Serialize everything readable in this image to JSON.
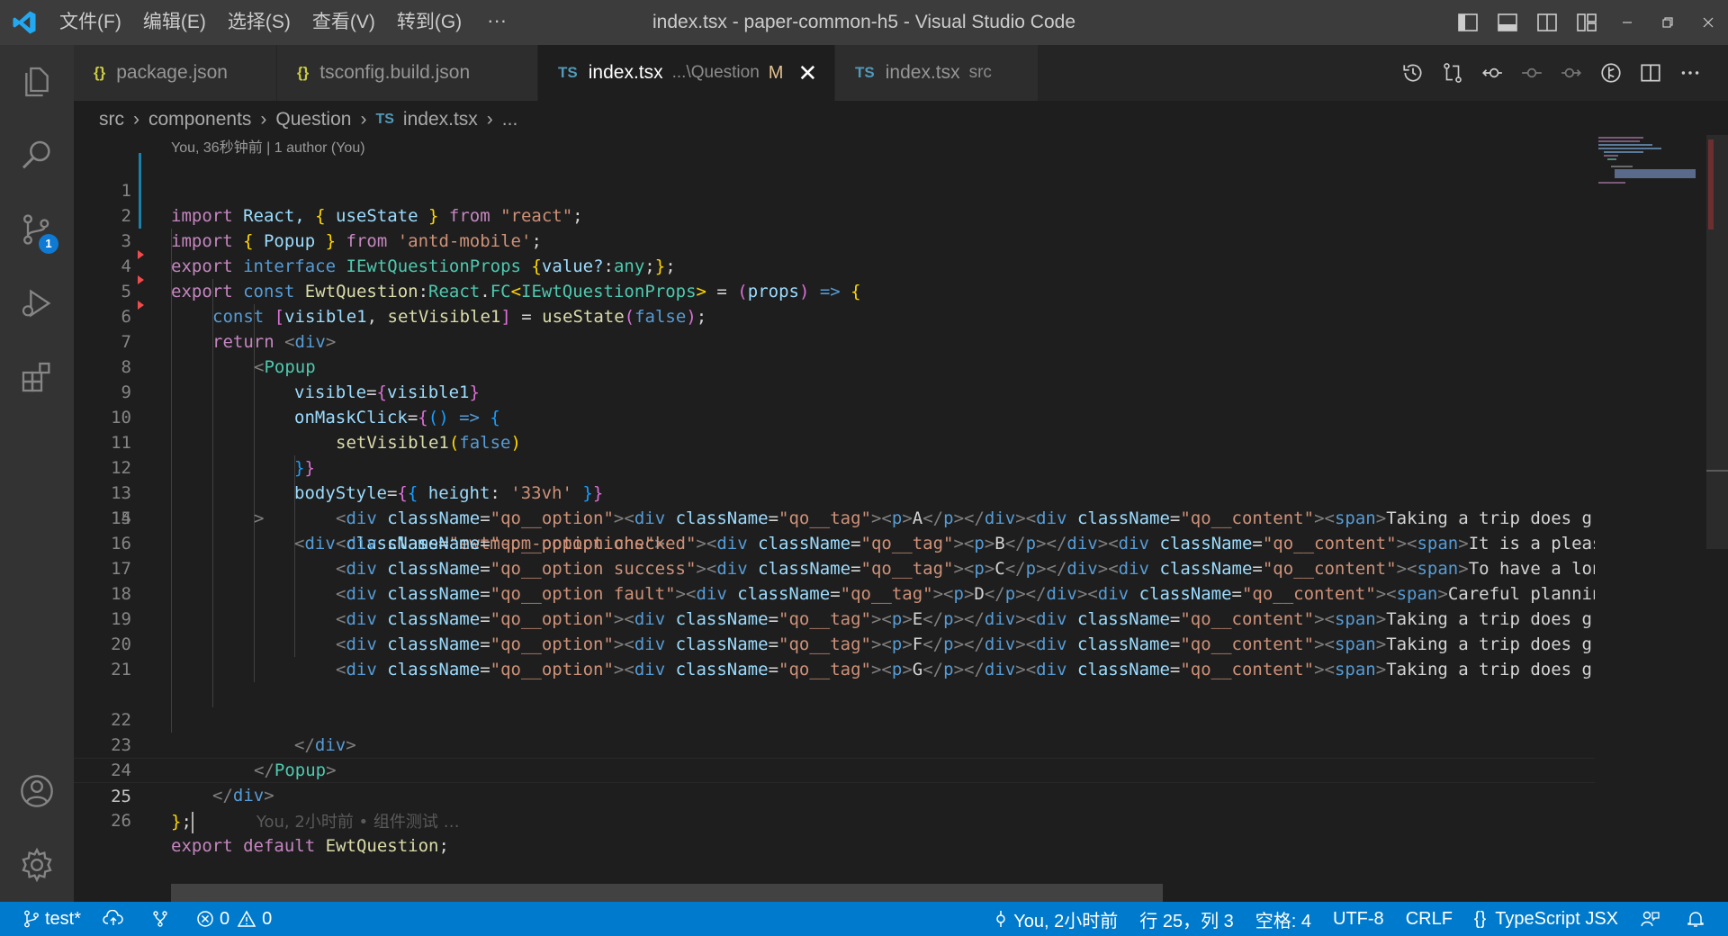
{
  "window": {
    "title": "index.tsx - paper-common-h5 - Visual Studio Code",
    "menu": [
      "文件(F)",
      "编辑(E)",
      "选择(S)",
      "查看(V)",
      "转到(G)"
    ],
    "more": "···"
  },
  "tabs": [
    {
      "icon": "{}",
      "label": "package.json"
    },
    {
      "icon": "{}",
      "label": "tsconfig.build.json"
    },
    {
      "icon": "TS",
      "label": "index.tsx",
      "desc": "...\\Question",
      "status": "M",
      "close": "✕"
    },
    {
      "icon": "TS",
      "label": "index.tsx",
      "desc": "src"
    }
  ],
  "breadcrumb": {
    "items": [
      "src",
      "components",
      "Question"
    ],
    "file_icon": "TS",
    "file": "index.tsx",
    "tail": "..."
  },
  "codelens": "You, 36秒钟前 | 1 author (You)",
  "line_numbers": [
    "1",
    "2",
    "3",
    "4",
    "5",
    "6",
    "7",
    "8",
    "9",
    "10",
    "11",
    "12",
    "13",
    "14",
    "15",
    "16",
    "17",
    "18",
    "19",
    "20",
    "21",
    "22",
    "23",
    "24",
    "25",
    "26"
  ],
  "code": {
    "l1": [
      "import",
      " React, ",
      "{",
      " useState ",
      "}",
      " from ",
      "\"react\"",
      ";"
    ],
    "l2": [
      "import",
      " ",
      "{",
      " Popup ",
      "}",
      " from ",
      "'antd-mobile'",
      ";"
    ],
    "l3": [
      "export",
      " ",
      "interface",
      " ",
      "IEwtQuestionProps",
      " ",
      "{",
      "value?",
      ":",
      "any",
      ";",
      "}",
      ";"
    ],
    "l4": [
      "export",
      " ",
      "const",
      " ",
      "EwtQuestion",
      ":",
      "React",
      ".",
      "FC",
      "<",
      "IEwtQuestionProps",
      ">",
      " = ",
      "(",
      "props",
      ")",
      " => ",
      "{"
    ],
    "l5": [
      "const",
      " ",
      "[",
      "visible1",
      ", ",
      "setVisible1",
      "]",
      " = ",
      "useState",
      "(",
      "false",
      ")",
      ";"
    ],
    "l6": [
      "return",
      " ",
      "<",
      "div",
      ">"
    ],
    "l7": [
      "<",
      "Popup"
    ],
    "l8": [
      "visible",
      "=",
      "{",
      "visible1",
      "}"
    ],
    "l9": [
      "onMaskClick",
      "=",
      "{",
      "(",
      ")",
      " => ",
      "{"
    ],
    "l10": [
      "setVisible1",
      "(",
      "false",
      ")"
    ],
    "l11": [
      "}",
      "}"
    ],
    "l12": [
      "bodyStyle",
      "=",
      "{",
      "{",
      " ",
      "height",
      ": ",
      "'33vh'",
      " ",
      "}",
      "}"
    ],
    "l13": [
      ">"
    ],
    "l14": [
      "<",
      "div",
      " ",
      "className",
      "=",
      "\"ewtm-pm-popoptions\"",
      ">"
    ],
    "options": [
      {
        "cls": "\"qo__option\"",
        "tag": "A",
        "text": "Taking a trip does gr"
      },
      {
        "cls": "\"qo__option checked\"",
        "tag": "B",
        "text": "It is a pleas"
      },
      {
        "cls": "\"qo__option success\"",
        "tag": "C",
        "text": "To have a lon"
      },
      {
        "cls": "\"qo__option fault\"",
        "tag": "D",
        "text": "Careful plannin"
      },
      {
        "cls": "\"qo__option\"",
        "tag": "E",
        "text": "Taking a trip does gr"
      },
      {
        "cls": "\"qo__option\"",
        "tag": "F",
        "text": "Taking a trip does gr"
      },
      {
        "cls": "\"qo__option\"",
        "tag": "G",
        "text": "Taking a trip does gr"
      }
    ],
    "opt_parts": {
      "open": "<",
      "div": "div",
      "classname": "className",
      "eq": "=",
      "gt": ">",
      "tagcls": "\"qo__tag\"",
      "contentcls": "\"qo__content\"",
      "p": "p",
      "close_p": "</",
      "close_div": "</",
      "span": "span"
    },
    "l22": [
      "</",
      "div",
      ">"
    ],
    "l23": [
      "</",
      "Popup",
      ">"
    ],
    "l24": [
      "</",
      "div",
      ">"
    ],
    "l25": [
      "}",
      ";"
    ],
    "l25_ghost": "You, 2小时前 • 组件测试 …",
    "l26": [
      "export",
      " ",
      "default",
      " ",
      "EwtQuestion",
      ";"
    ]
  },
  "statusbar": {
    "branch": "test*",
    "errors": "0",
    "warnings": "0",
    "blame": "You, 2小时前",
    "position": "行 25，列 3",
    "spaces": "空格: 4",
    "encoding": "UTF-8",
    "eol": "CRLF",
    "language_icon": "{}",
    "language": "TypeScript JSX"
  },
  "activity": {
    "scm_badge": "1"
  },
  "colors": {
    "accent": "#007acc",
    "titlebar": "#3c3c3c",
    "editor_bg": "#1e1e1e",
    "activitybar": "#333333"
  }
}
